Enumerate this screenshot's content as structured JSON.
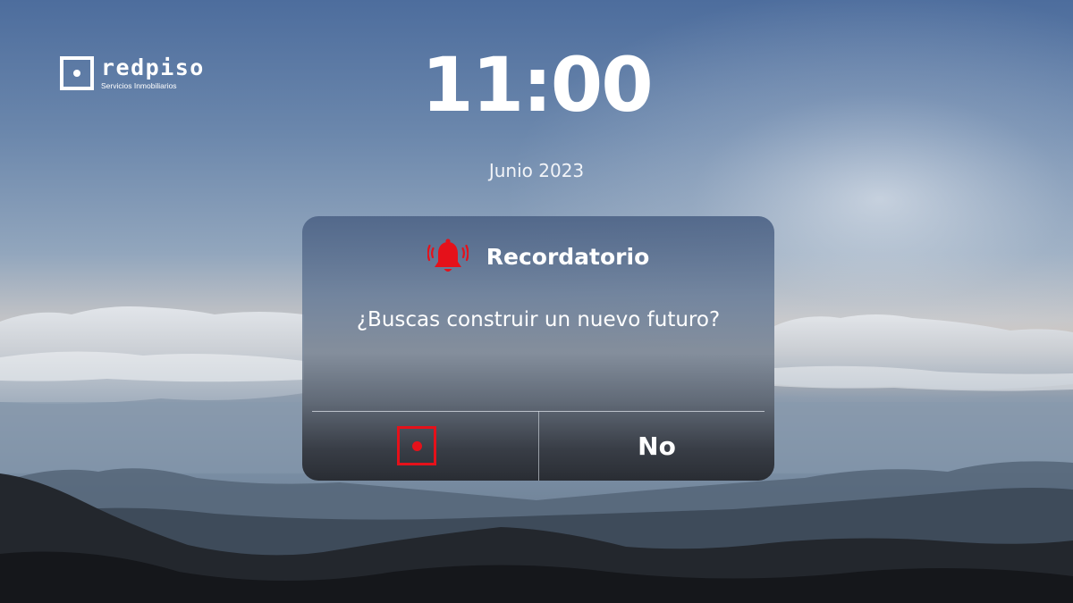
{
  "brand": {
    "name": "redpiso",
    "tagline": "Servicios Inmobiliarios"
  },
  "lockscreen": {
    "time": "11:00",
    "date": "Junio 2023"
  },
  "dialog": {
    "icon": "bell-ringing-icon",
    "title": "Recordatorio",
    "message": "¿Buscas construir un nuevo futuro?",
    "yes_icon": "record-icon",
    "no_label": "No"
  },
  "colors": {
    "accent_red": "#e5111a",
    "text": "#ffffff"
  }
}
